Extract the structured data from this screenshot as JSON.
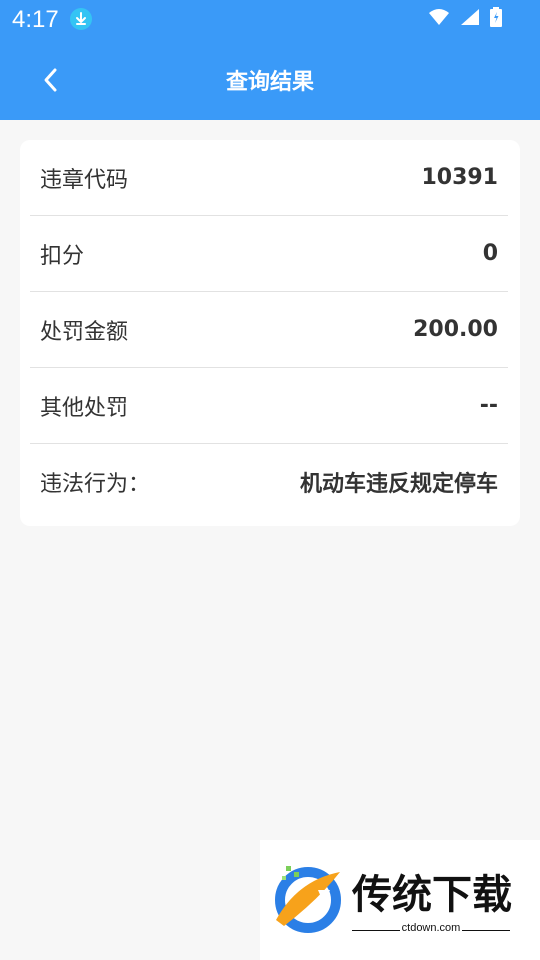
{
  "status_bar": {
    "time": "4:17"
  },
  "toolbar": {
    "title": "查询结果"
  },
  "result": {
    "rows": [
      {
        "label": "违章代码",
        "value": "10391"
      },
      {
        "label": "扣分",
        "value": "0"
      },
      {
        "label": "处罚金额",
        "value": "200.00"
      },
      {
        "label": "其他处罚",
        "value": "--"
      },
      {
        "label": "违法行为：",
        "value": "机动车违反规定停车"
      }
    ]
  },
  "watermark": {
    "brand": "传统下载",
    "url": "ctdown.com"
  },
  "colors": {
    "primary": "#3a9af8",
    "background": "#f7f7f7",
    "card": "#ffffff",
    "text": "#333333"
  }
}
